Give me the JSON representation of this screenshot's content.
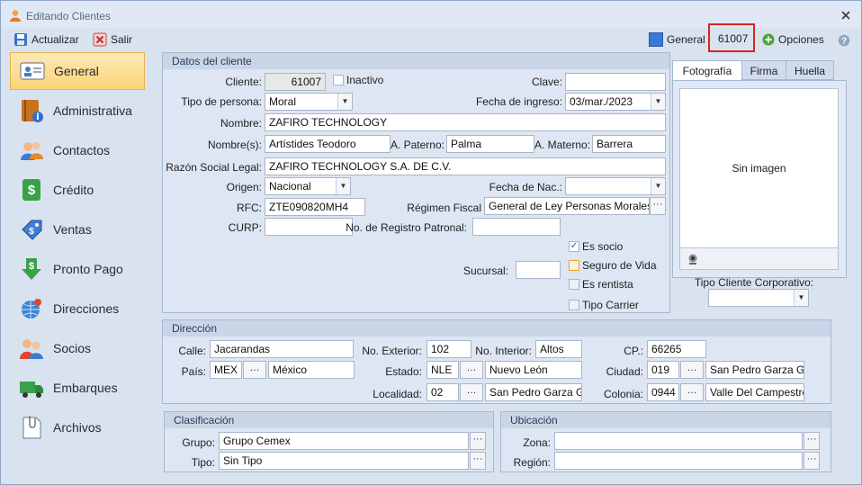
{
  "window": {
    "title": "Editando Clientes"
  },
  "toolbar": {
    "refresh_label": "Actualizar",
    "exit_label": "Salir",
    "general_label": "General",
    "client_code": "61007",
    "options_label": "Opciones"
  },
  "nav": {
    "items": [
      {
        "label": "General"
      },
      {
        "label": "Administrativa"
      },
      {
        "label": "Contactos"
      },
      {
        "label": "Crédito"
      },
      {
        "label": "Ventas"
      },
      {
        "label": "Pronto Pago"
      },
      {
        "label": "Direcciones"
      },
      {
        "label": "Socios"
      },
      {
        "label": "Embarques"
      },
      {
        "label": "Archivos"
      }
    ]
  },
  "datos": {
    "title": "Datos del cliente",
    "cliente_label": "Cliente:",
    "cliente_value": "61007",
    "inactivo_label": "Inactivo",
    "clave_label": "Clave:",
    "clave_value": "",
    "tipo_persona_label": "Tipo de persona:",
    "tipo_persona_value": "Moral",
    "fecha_ingreso_label": "Fecha de ingreso:",
    "fecha_ingreso_value": "03/mar./2023",
    "nombre_label": "Nombre:",
    "nombre_value": "ZAFIRO TECHNOLOGY",
    "nombres_label": "Nombre(s):",
    "nombres_value": "Artístides Teodoro",
    "apaterno_label": "A. Paterno:",
    "apaterno_value": "Palma",
    "amaterno_label": "A. Materno:",
    "amaterno_value": "Barrera",
    "razon_label": "Razón Social Legal:",
    "razon_value": "ZAFIRO TECHNOLOGY S.A. DE C.V.",
    "origen_label": "Origen:",
    "origen_value": "Nacional",
    "fecha_nac_label": "Fecha de Nac.:",
    "fecha_nac_value": "",
    "rfc_label": "RFC:",
    "rfc_value": "ZTE090820MH4",
    "regimen_label": "Régimen Fiscal",
    "regimen_value": "General de Ley Personas Morales",
    "curp_label": "CURP:",
    "curp_value": "",
    "registro_label": "No. de Registro Patronal:",
    "registro_value": "",
    "es_socio_label": "Es socio",
    "seguro_label": "Seguro de Vida",
    "rentista_label": "Es rentista",
    "carrier_label": "Tipo Carrier",
    "sucursal_label": "Sucursal:",
    "sucursal_value": ""
  },
  "photo": {
    "tabs": [
      "Fotografía",
      "Firma",
      "Huella"
    ],
    "empty_text": "Sin imagen",
    "tipo_cliente_label": "Tipo Cliente Corporativo:"
  },
  "direccion": {
    "title": "Dirección",
    "calle_label": "Calle:",
    "calle_value": "Jacarandas",
    "no_ext_label": "No. Exterior:",
    "no_ext_value": "102",
    "no_int_label": "No. Interior:",
    "no_int_value": "Altos",
    "cp_label": "CP.:",
    "cp_value": "66265",
    "pais_label": "País:",
    "pais_code": "MEX",
    "pais_value": "México",
    "estado_label": "Estado:",
    "estado_code": "NLE",
    "estado_value": "Nuevo León",
    "ciudad_label": "Ciudad:",
    "ciudad_code": "019",
    "ciudad_value": "San Pedro Garza García",
    "localidad_label": "Localidad:",
    "localidad_code": "02",
    "localidad_value": "San Pedro Garza García",
    "colonia_label": "Colonia:",
    "colonia_code": "0944",
    "colonia_value": "Valle Del Campestre"
  },
  "clasificacion": {
    "title": "Clasificación",
    "grupo_label": "Grupo:",
    "grupo_value": "Grupo Cemex",
    "tipo_label": "Tipo:",
    "tipo_value": "Sin Tipo"
  },
  "ubicacion": {
    "title": "Ubicación",
    "zona_label": "Zona:",
    "zona_value": "",
    "region_label": "Región:",
    "region_value": ""
  },
  "colors": {
    "highlight": "#e02020",
    "active_nav": "#fbd477",
    "accent_blue": "#2f6fcf"
  }
}
